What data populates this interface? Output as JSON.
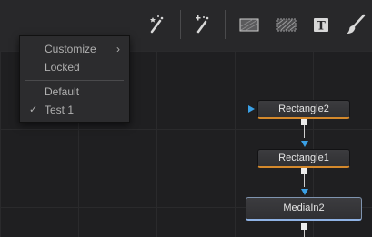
{
  "toolbar": {
    "icons": [
      "magic-wand-icon",
      "magic-wand-plus-icon",
      "rectangle-mask-icon",
      "gradient-mask-icon",
      "text-icon",
      "paint-brush-icon"
    ],
    "text_tool_label": "T"
  },
  "menu": {
    "items": [
      {
        "label": "Customize",
        "has_submenu": true,
        "chevron": "›"
      },
      {
        "label": "Locked"
      },
      {
        "label": "Default"
      },
      {
        "label": "Test 1",
        "checked": true,
        "check": "✓"
      }
    ]
  },
  "nodes": [
    {
      "label": "Rectangle2",
      "accent": "#d4892c"
    },
    {
      "label": "Rectangle1",
      "accent": "#d4892c"
    },
    {
      "label": "MediaIn2",
      "accent": "#8fb2e4"
    }
  ],
  "colors": {
    "link_arrow": "#3aa0e6",
    "background": "#202022",
    "toolbar": "#28282a"
  }
}
